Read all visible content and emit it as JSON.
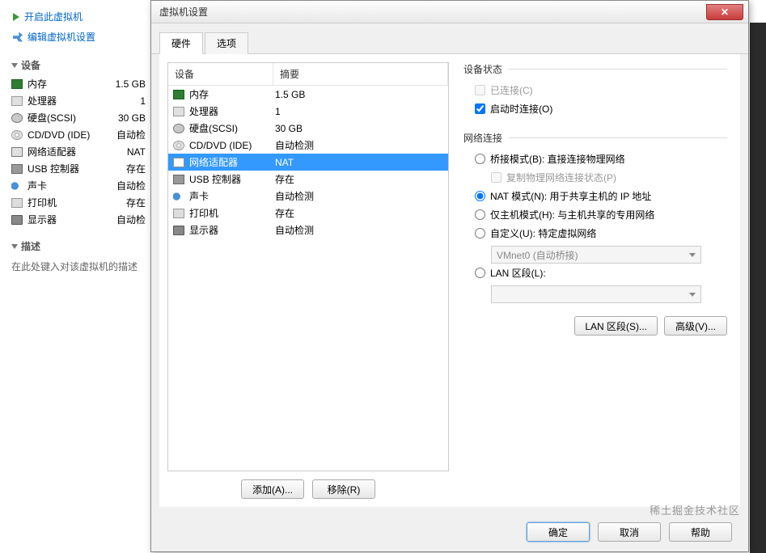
{
  "left": {
    "power_on": "开启此虚拟机",
    "edit_settings": "编辑虚拟机设置",
    "section_devices": "设备",
    "section_desc": "描述",
    "desc_placeholder": "在此处键入对该虚拟机的描述",
    "devices": [
      {
        "name": "内存",
        "value": "1.5 GB",
        "icon": "ic-mem"
      },
      {
        "name": "处理器",
        "value": "1",
        "icon": "ic-cpu"
      },
      {
        "name": "硬盘(SCSI)",
        "value": "30 GB",
        "icon": "ic-disk"
      },
      {
        "name": "CD/DVD (IDE)",
        "value": "自动检",
        "icon": "ic-cd"
      },
      {
        "name": "网络适配器",
        "value": "NAT",
        "icon": "ic-net"
      },
      {
        "name": "USB 控制器",
        "value": "存在",
        "icon": "ic-usb"
      },
      {
        "name": "声卡",
        "value": "自动检",
        "icon": "ic-snd"
      },
      {
        "name": "打印机",
        "value": "存在",
        "icon": "ic-prn"
      },
      {
        "name": "显示器",
        "value": "自动检",
        "icon": "ic-dsp"
      }
    ]
  },
  "dialog": {
    "title": "虚拟机设置",
    "tabs": {
      "hardware": "硬件",
      "options": "选项"
    },
    "columns": {
      "device": "设备",
      "summary": "摘要"
    },
    "hw_list": [
      {
        "name": "内存",
        "summary": "1.5 GB",
        "icon": "ic-mem",
        "selected": false
      },
      {
        "name": "处理器",
        "summary": "1",
        "icon": "ic-cpu",
        "selected": false
      },
      {
        "name": "硬盘(SCSI)",
        "summary": "30 GB",
        "icon": "ic-disk",
        "selected": false
      },
      {
        "name": "CD/DVD (IDE)",
        "summary": "自动检测",
        "icon": "ic-cd",
        "selected": false
      },
      {
        "name": "网络适配器",
        "summary": "NAT",
        "icon": "ic-net",
        "selected": true
      },
      {
        "name": "USB 控制器",
        "summary": "存在",
        "icon": "ic-usb",
        "selected": false
      },
      {
        "name": "声卡",
        "summary": "自动检测",
        "icon": "ic-snd",
        "selected": false
      },
      {
        "name": "打印机",
        "summary": "存在",
        "icon": "ic-prn",
        "selected": false
      },
      {
        "name": "显示器",
        "summary": "自动检测",
        "icon": "ic-dsp",
        "selected": false
      }
    ],
    "buttons": {
      "add": "添加(A)...",
      "remove": "移除(R)",
      "ok": "确定",
      "cancel": "取消",
      "help": "帮助",
      "lan_segments": "LAN 区段(S)...",
      "advanced": "高级(V)..."
    },
    "device_status": {
      "title": "设备状态",
      "connected": "已连接(C)",
      "connect_at_power_on": "启动时连接(O)"
    },
    "net": {
      "title": "网络连接",
      "bridged": "桥接模式(B): 直接连接物理网络",
      "replicate": "复制物理网络连接状态(P)",
      "nat": "NAT 模式(N): 用于共享主机的 IP 地址",
      "hostonly": "仅主机模式(H): 与主机共享的专用网络",
      "custom": "自定义(U): 特定虚拟网络",
      "custom_combo": "VMnet0 (自动桥接)",
      "lan": "LAN 区段(L):",
      "lan_combo": ""
    }
  },
  "watermark": "稀土掘金技术社区"
}
